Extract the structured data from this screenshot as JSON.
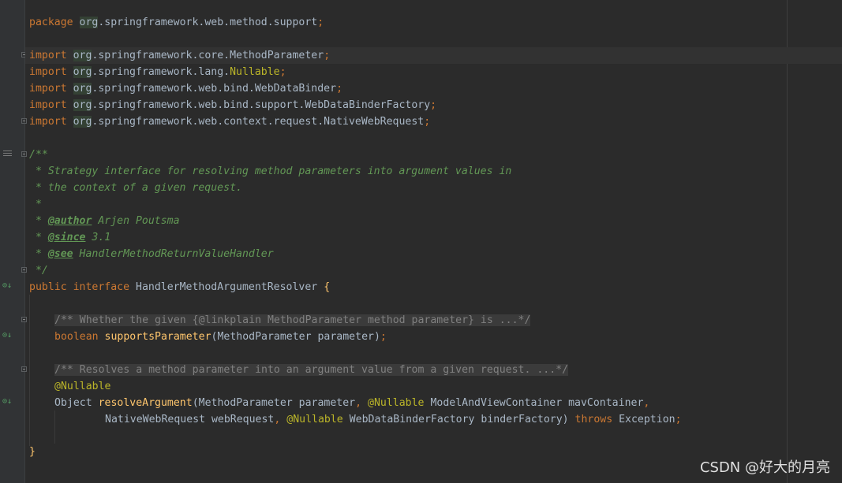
{
  "package_line": {
    "kw": "package",
    "first": "org",
    "rest": ".springframework.web.method.support",
    "semi": ";"
  },
  "imports": [
    {
      "kw": "import",
      "first": "org",
      "rest": ".springframework.core.MethodParameter",
      "highlight": "",
      "semi": ";"
    },
    {
      "kw": "import",
      "first": "org",
      "rest": ".springframework.lang.",
      "highlight": "Nullable",
      "semi": ";"
    },
    {
      "kw": "import",
      "first": "org",
      "rest": ".springframework.web.bind.WebDataBinder",
      "highlight": "",
      "semi": ";"
    },
    {
      "kw": "import",
      "first": "org",
      "rest": ".springframework.web.bind.support.WebDataBinderFactory",
      "highlight": "",
      "semi": ";"
    },
    {
      "kw": "import",
      "first": "org",
      "rest": ".springframework.web.context.request.NativeWebRequest",
      "highlight": "",
      "semi": ";"
    }
  ],
  "javadoc": {
    "open": "/**",
    "line1": " * Strategy interface for resolving method parameters into argument values in",
    "line2": " * the context of a given request.",
    "line3": " *",
    "author_tag": "@author",
    "author_val": " Arjen Poutsma",
    "since_tag": "@since",
    "since_val": " 3.1",
    "see_tag": "@see",
    "see_val": " HandlerMethodReturnValueHandler",
    "close": " */",
    "prefix": " * "
  },
  "iface": {
    "kw1": "public",
    "kw2": "interface",
    "name": " HandlerMethodArgumentResolver ",
    "brace": "{"
  },
  "method1": {
    "doc": "/** Whether the given {@linkplain MethodParameter method parameter} is ...*/",
    "ret": "boolean",
    "name": "supportsParameter",
    "params": "(MethodParameter parameter)",
    "semi": ";"
  },
  "method2": {
    "doc": "/** Resolves a method parameter into an argument value from a given request. ...*/",
    "annotation": "@Nullable",
    "ret": "Object",
    "name": "resolveArgument",
    "p1": "(MethodParameter parameter",
    "comma": ",",
    "ann2": "@Nullable",
    "p2": " ModelAndViewContainer mavContainer",
    "p3": "NativeWebRequest webRequest",
    "ann3": "@Nullable",
    "p4": " WebDataBinderFactory binderFactory)",
    "throws": "throws",
    "exc": " Exception",
    "semi": ";"
  },
  "closing_brace": "}",
  "watermark": "CSDN @好大的月亮",
  "colors": {
    "background": "#2b2b2b",
    "keyword": "#cc7832",
    "annotation": "#bbb529",
    "method": "#ffc66d",
    "doc": "#629755"
  }
}
